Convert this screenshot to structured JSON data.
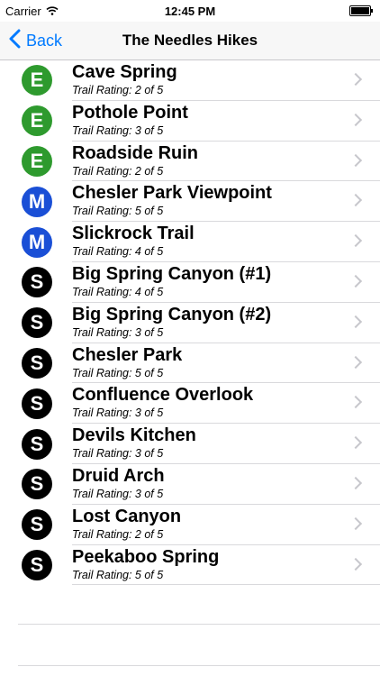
{
  "status": {
    "carrier": "Carrier",
    "time": "12:45 PM"
  },
  "nav": {
    "back_label": "Back",
    "title": "The Needles Hikes"
  },
  "colors": {
    "E": "#2e9a2e",
    "M": "#1a4fd6",
    "S": "#000000",
    "accent": "#007aff"
  },
  "trails": [
    {
      "badge": "E",
      "name": "Cave Spring",
      "rating": "Trail Rating: 2 of 5"
    },
    {
      "badge": "E",
      "name": "Pothole Point",
      "rating": "Trail Rating: 3 of 5"
    },
    {
      "badge": "E",
      "name": "Roadside Ruin",
      "rating": "Trail Rating: 2 of 5"
    },
    {
      "badge": "M",
      "name": "Chesler Park Viewpoint",
      "rating": "Trail Rating: 5 of 5"
    },
    {
      "badge": "M",
      "name": "Slickrock Trail",
      "rating": "Trail Rating: 4 of 5"
    },
    {
      "badge": "S",
      "name": "Big Spring Canyon (#1)",
      "rating": "Trail Rating: 4 of 5"
    },
    {
      "badge": "S",
      "name": "Big Spring Canyon (#2)",
      "rating": "Trail Rating: 3 of 5"
    },
    {
      "badge": "S",
      "name": "Chesler Park",
      "rating": "Trail Rating: 5 of 5"
    },
    {
      "badge": "S",
      "name": "Confluence Overlook",
      "rating": "Trail Rating: 3 of 5"
    },
    {
      "badge": "S",
      "name": "Devils Kitchen",
      "rating": "Trail Rating: 3 of 5"
    },
    {
      "badge": "S",
      "name": "Druid Arch",
      "rating": "Trail Rating: 3 of 5"
    },
    {
      "badge": "S",
      "name": "Lost Canyon",
      "rating": "Trail Rating: 2 of 5"
    },
    {
      "badge": "S",
      "name": "Peekaboo Spring",
      "rating": "Trail Rating: 5 of 5"
    }
  ]
}
